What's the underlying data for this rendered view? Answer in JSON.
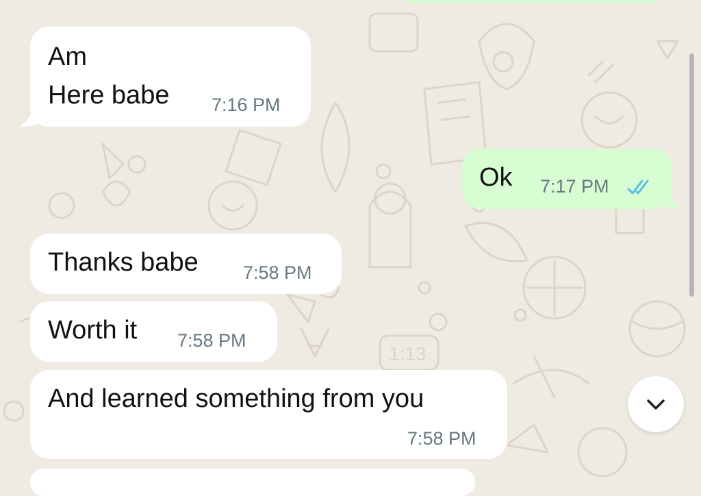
{
  "messages": [
    {
      "direction": "incoming",
      "lines": [
        "Am",
        "Here babe"
      ],
      "time": "7:16 PM"
    },
    {
      "direction": "outgoing",
      "lines": [
        "Ok"
      ],
      "time": "7:17 PM",
      "status": "read"
    },
    {
      "direction": "incoming",
      "lines": [
        "Thanks babe"
      ],
      "time": "7:58 PM"
    },
    {
      "direction": "incoming",
      "lines": [
        "Worth it"
      ],
      "time": "7:58 PM"
    },
    {
      "direction": "incoming",
      "lines": [
        "And learned something from you"
      ],
      "time": "7:58 PM"
    }
  ],
  "wallpaper_clock_text": "1:13",
  "colors": {
    "wallpaper": "#efeae2",
    "incoming_bubble": "#ffffff",
    "outgoing_bubble": "#d9fdd3",
    "timestamp": "#667781",
    "read_ticks": "#53bdeb"
  },
  "icons": {
    "read_receipt": "double-check-icon",
    "scroll_down": "chevron-down-icon"
  }
}
